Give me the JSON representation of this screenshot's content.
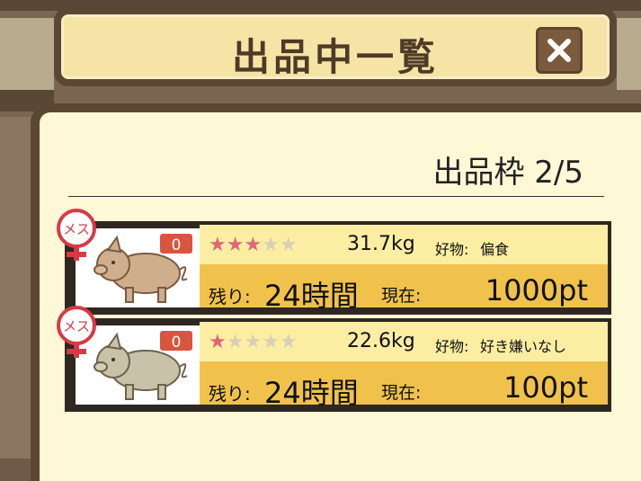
{
  "header": {
    "title": "出品中一覧",
    "close_icon": "close-icon"
  },
  "panel": {
    "slot_label": "出品枠 2/5"
  },
  "listings": [
    {
      "sex": "メス",
      "bid_count": "0",
      "rating": 3,
      "max_rating": 5,
      "weight": "31.7kg",
      "pref_label": "好物:",
      "pref_value": "偏食",
      "remain_label": "残り:",
      "remain_value": "24時間",
      "current_label": "現在:",
      "price": "1000pt",
      "pig_color": "#cfae8d"
    },
    {
      "sex": "メス",
      "bid_count": "0",
      "rating": 1,
      "max_rating": 5,
      "weight": "22.6kg",
      "pref_label": "好物:",
      "pref_value": "好き嫌いなし",
      "remain_label": "残り:",
      "remain_value": "24時間",
      "current_label": "現在:",
      "price": "100pt",
      "pig_color": "#c9c2a9"
    }
  ],
  "colors": {
    "wood_dark": "#5b4733",
    "panel_bg": "#fff8d6",
    "band_top": "#fbeea3",
    "band_bottom": "#f0c24c",
    "star_on": "#e2657c",
    "badge": "#d9553d"
  }
}
